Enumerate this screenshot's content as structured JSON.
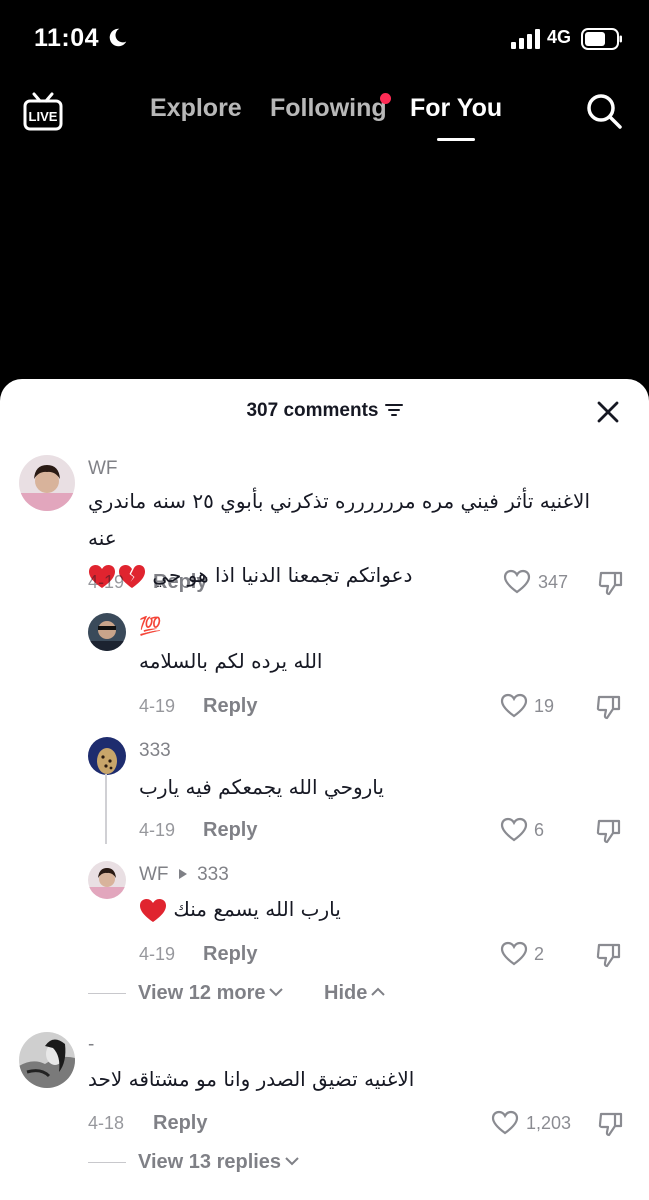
{
  "status_bar": {
    "time": "11:04",
    "network": "4G"
  },
  "top_nav": {
    "tabs": [
      {
        "label": "Explore"
      },
      {
        "label": "Following"
      },
      {
        "label": "For You"
      }
    ]
  },
  "comments_panel": {
    "title": "307 comments",
    "comments": [
      {
        "username": "WF",
        "text_line1": "الاغنيه تأثر فيني مره مرررررره تذكرني بأبوي ٢٥ سنه ماندري عنه",
        "text_line2": "دعواتكم تجمعنا الدنيا اذا هو حي",
        "date": "4-19",
        "reply_label": "Reply",
        "likes": "347"
      },
      {
        "username": "💯",
        "text": "الله يرده لكم بالسلامه",
        "date": "4-19",
        "reply_label": "Reply",
        "likes": "19"
      },
      {
        "username": "333",
        "text": "ياروحي الله يجمعكم فيه يارب",
        "date": "4-19",
        "reply_label": "Reply",
        "likes": "6"
      },
      {
        "username": "WF",
        "reply_to": "333",
        "text": "يارب الله يسمع منك",
        "date": "4-19",
        "reply_label": "Reply",
        "likes": "2"
      },
      {
        "username": "-",
        "text": "الاغنيه تضيق الصدر وانا مو مشتاقه لاحد",
        "date": "4-18",
        "reply_label": "Reply",
        "likes": "1,203"
      }
    ],
    "view_more_label": "View 12 more",
    "hide_label": "Hide",
    "view_replies_label": "View 13 replies"
  },
  "colors": {
    "background_top": "#000000",
    "sheet_background": "#ffffff",
    "accent_dot": "#fe2c55",
    "heart_red": "#e0242f"
  }
}
